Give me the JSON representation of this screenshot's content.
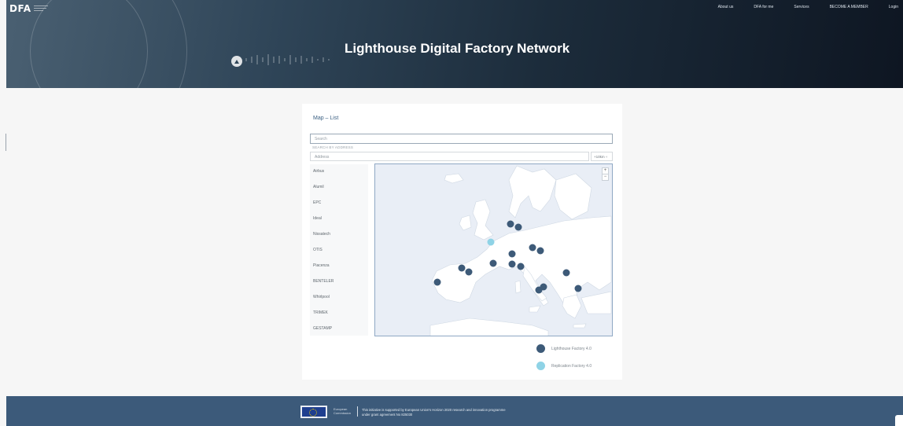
{
  "header": {
    "logo": "DFA",
    "logo_subtitle": "",
    "nav": [
      "About us",
      "DFA for me",
      "Services",
      "BECOME A MEMBER",
      "Login"
    ],
    "title": "Lighthouse Digital Factory Network"
  },
  "card": {
    "title": "Map – List",
    "search_placeholder": "Search",
    "search_by_address": "SEARCH BY ADDRESS",
    "address_placeholder": "Address",
    "radius": "+10km ÷",
    "companies": [
      "Airbus",
      "Alumil",
      "EPC",
      "Ideal",
      "Nissatech",
      "OTIS",
      "Piacenza",
      "BENTELER",
      "Whirlpool",
      "TRIMEK",
      "GESTAMP"
    ]
  },
  "map": {
    "zoom_in": "+",
    "zoom_out": "−",
    "colors": {
      "lighthouse": "#3d5a78",
      "replication": "#8fd3e6",
      "land": "#ffffff",
      "sea": "#e9eef6"
    }
  },
  "legend": {
    "lighthouse": "Lighthouse Factory 4.0",
    "replication": "Replication Factory 4.0"
  },
  "footer": {
    "eu_line1": "European",
    "eu_line2": "Commission",
    "text_line1": "This initiative is supported by European Union's Horizon 2020 research and innovation programme",
    "text_line2": "under grant agreement No 825030"
  }
}
